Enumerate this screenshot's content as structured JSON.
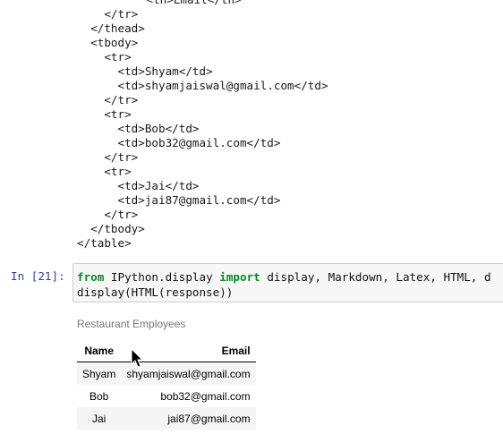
{
  "output_lines": [
    "      <th>Email</th>",
    "    </tr>",
    "  </thead>",
    "  <tbody>",
    "    <tr>",
    "      <td>Shyam</td>",
    "      <td>shyamjaiswal@gmail.com</td>",
    "    </tr>",
    "    <tr>",
    "      <td>Bob</td>",
    "      <td>bob32@gmail.com</td>",
    "    </tr>",
    "    <tr>",
    "      <td>Jai</td>",
    "      <td>jai87@gmail.com</td>",
    "    </tr>",
    "  </tbody>",
    "</table>"
  ],
  "cell": {
    "prompt": "In [21]:",
    "line1": {
      "kw_from": "from",
      "module": " IPython.display ",
      "kw_import": "import",
      "names": " display, Markdown, Latex, HTML, d"
    },
    "line2": "display(HTML(response))"
  },
  "result": {
    "caption": "Restaurant Employees",
    "headers": [
      "Name",
      "Email"
    ],
    "rows": [
      [
        "Shyam",
        "shyamjaiswal@gmail.com"
      ],
      [
        "Bob",
        "bob32@gmail.com"
      ],
      [
        "Jai",
        "jai87@gmail.com"
      ]
    ]
  }
}
